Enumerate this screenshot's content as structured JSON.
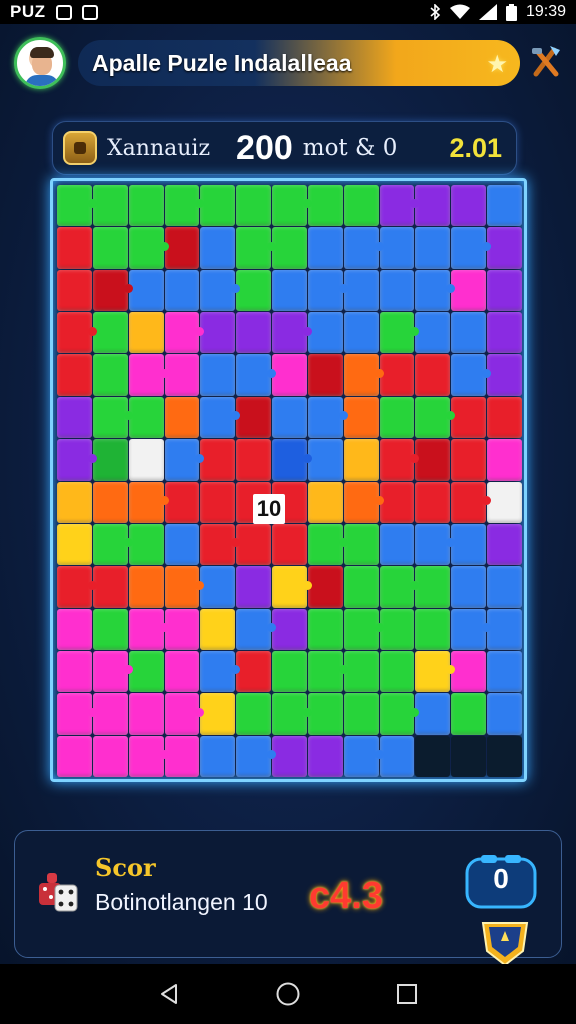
{
  "status_bar": {
    "app_label": "PUZ",
    "time": "19:39"
  },
  "header": {
    "title": "Apalle Puzle Indalalleaa"
  },
  "score_bar": {
    "player_name": "Xannauiz",
    "score": "200",
    "moves_text": "mot & 0",
    "right_value": "2.01"
  },
  "board": {
    "rows": 14,
    "cols": 13,
    "tile_label": "10",
    "palette": {
      "g": "#27d43a",
      "G": "#1fb335",
      "b": "#2f7df0",
      "B": "#1e5fe0",
      "p": "#8a2be2",
      "P": "#7a24c9",
      "m": "#ff2fcf",
      "r": "#e81f2a",
      "R": "#c9101c",
      "o": "#ff6a12",
      "y": "#ffd21a",
      "Y": "#ffb81a",
      "w": "#f2f2f2",
      "x": "#0b1c2e"
    },
    "grid": [
      "gggggggggpppb",
      "rggRbggbbbbbp",
      "rRbbbgbbbbbmp",
      "rgYmpppbbgbbp",
      "rgmmbbmRorrbp",
      "pggobRbboggrr",
      "pGwbrrBbYrRrm",
      "YoorrrrYorrrw",
      "yggbrrrggbbbp",
      "rroobpyRgggbb",
      "mgmmybpggggbb",
      "mmgmbrggggymb",
      "mmmmygggggbgb",
      "mmmmbbppbbxxx"
    ]
  },
  "bottom_panel": {
    "label": "Scor",
    "subtitle": "Botinotlangen 10",
    "score": "c4.3",
    "controller_value": "0"
  },
  "colors": {
    "accent": "#f7b81e",
    "board_border": "#7fd3ff",
    "score_red": "#ff3b30"
  }
}
